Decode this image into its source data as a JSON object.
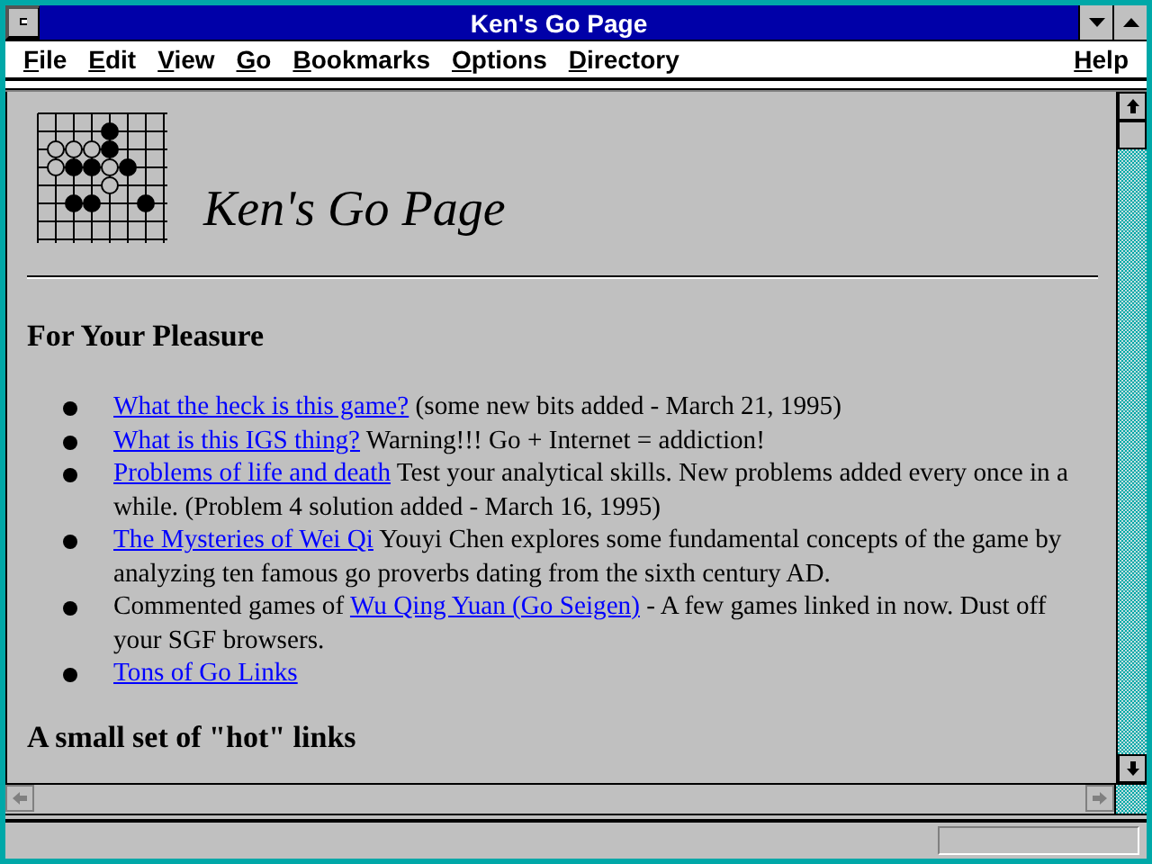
{
  "window": {
    "title": "Ken's Go Page"
  },
  "menu": [
    {
      "label": "File"
    },
    {
      "label": "Edit"
    },
    {
      "label": "View"
    },
    {
      "label": "Go"
    },
    {
      "label": "Bookmarks"
    },
    {
      "label": "Options"
    },
    {
      "label": "Directory"
    },
    {
      "label": "Help"
    }
  ],
  "page": {
    "logo_title": "Ken's Go Page",
    "heading": "For Your Pleasure",
    "items": [
      {
        "parts": [
          {
            "kind": "link",
            "text": "What the heck is this game?"
          },
          {
            "kind": "text",
            "text": " (some new bits added - March 21, 1995)"
          }
        ]
      },
      {
        "parts": [
          {
            "kind": "link",
            "text": "What is this IGS thing?"
          },
          {
            "kind": "text",
            "text": " Warning!!! Go + Internet = addiction!"
          }
        ]
      },
      {
        "parts": [
          {
            "kind": "link",
            "text": "Problems of life and death"
          },
          {
            "kind": "text",
            "text": " Test your analytical skills. New problems added every once in a while. (Problem 4 solution added - March 16, 1995)"
          }
        ]
      },
      {
        "parts": [
          {
            "kind": "link",
            "text": "The Mysteries of Wei Qi"
          },
          {
            "kind": "text",
            "text": " Youyi Chen explores some fundamental concepts of the game by analyzing ten famous go proverbs dating from the sixth century AD."
          }
        ]
      },
      {
        "parts": [
          {
            "kind": "text",
            "text": "Commented games of "
          },
          {
            "kind": "link",
            "text": "Wu Qing Yuan (Go Seigen)"
          },
          {
            "kind": "text",
            "text": " - A few games linked in now. Dust off your SGF browsers."
          }
        ]
      },
      {
        "parts": [
          {
            "kind": "link",
            "text": "Tons of Go Links"
          }
        ]
      }
    ],
    "next_heading": "A small set of \"hot\" links"
  }
}
